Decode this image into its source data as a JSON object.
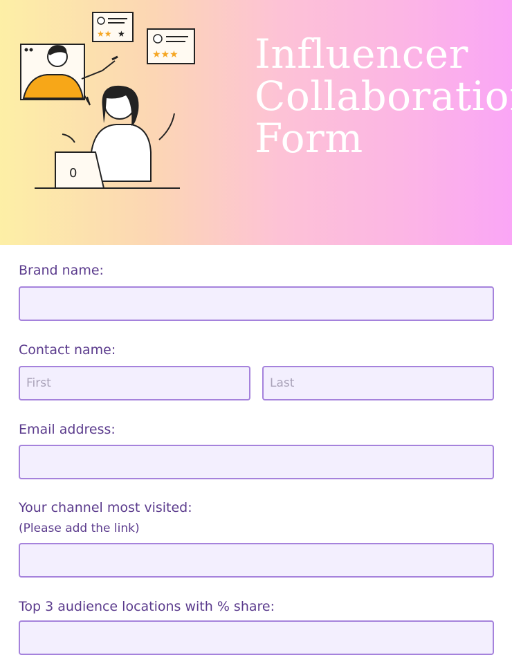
{
  "header": {
    "title": "Influencer\nCollaboration\nForm",
    "illustration": "two-people-video-call-illustration",
    "gradient_colors": [
      "#fdefa6",
      "#fcd6b4",
      "#fdc2d6",
      "#fcb6e4",
      "#faa6f6"
    ]
  },
  "form": {
    "brand_name": {
      "label": "Brand name:",
      "value": ""
    },
    "contact_name": {
      "label": "Contact name:",
      "first_placeholder": "First",
      "last_placeholder": "Last"
    },
    "email": {
      "label": "Email address:",
      "value": ""
    },
    "channel": {
      "label": "Your channel most visited:",
      "sublabel": "(Please add the link)",
      "value": ""
    },
    "locations": {
      "label": "Top 3 audience locations with % share:"
    }
  },
  "colors": {
    "label": "#5a3a8c",
    "field_bg": "#f3effe",
    "field_border": "#a582dc",
    "title": "#ffffff",
    "star": "#f5a623"
  }
}
